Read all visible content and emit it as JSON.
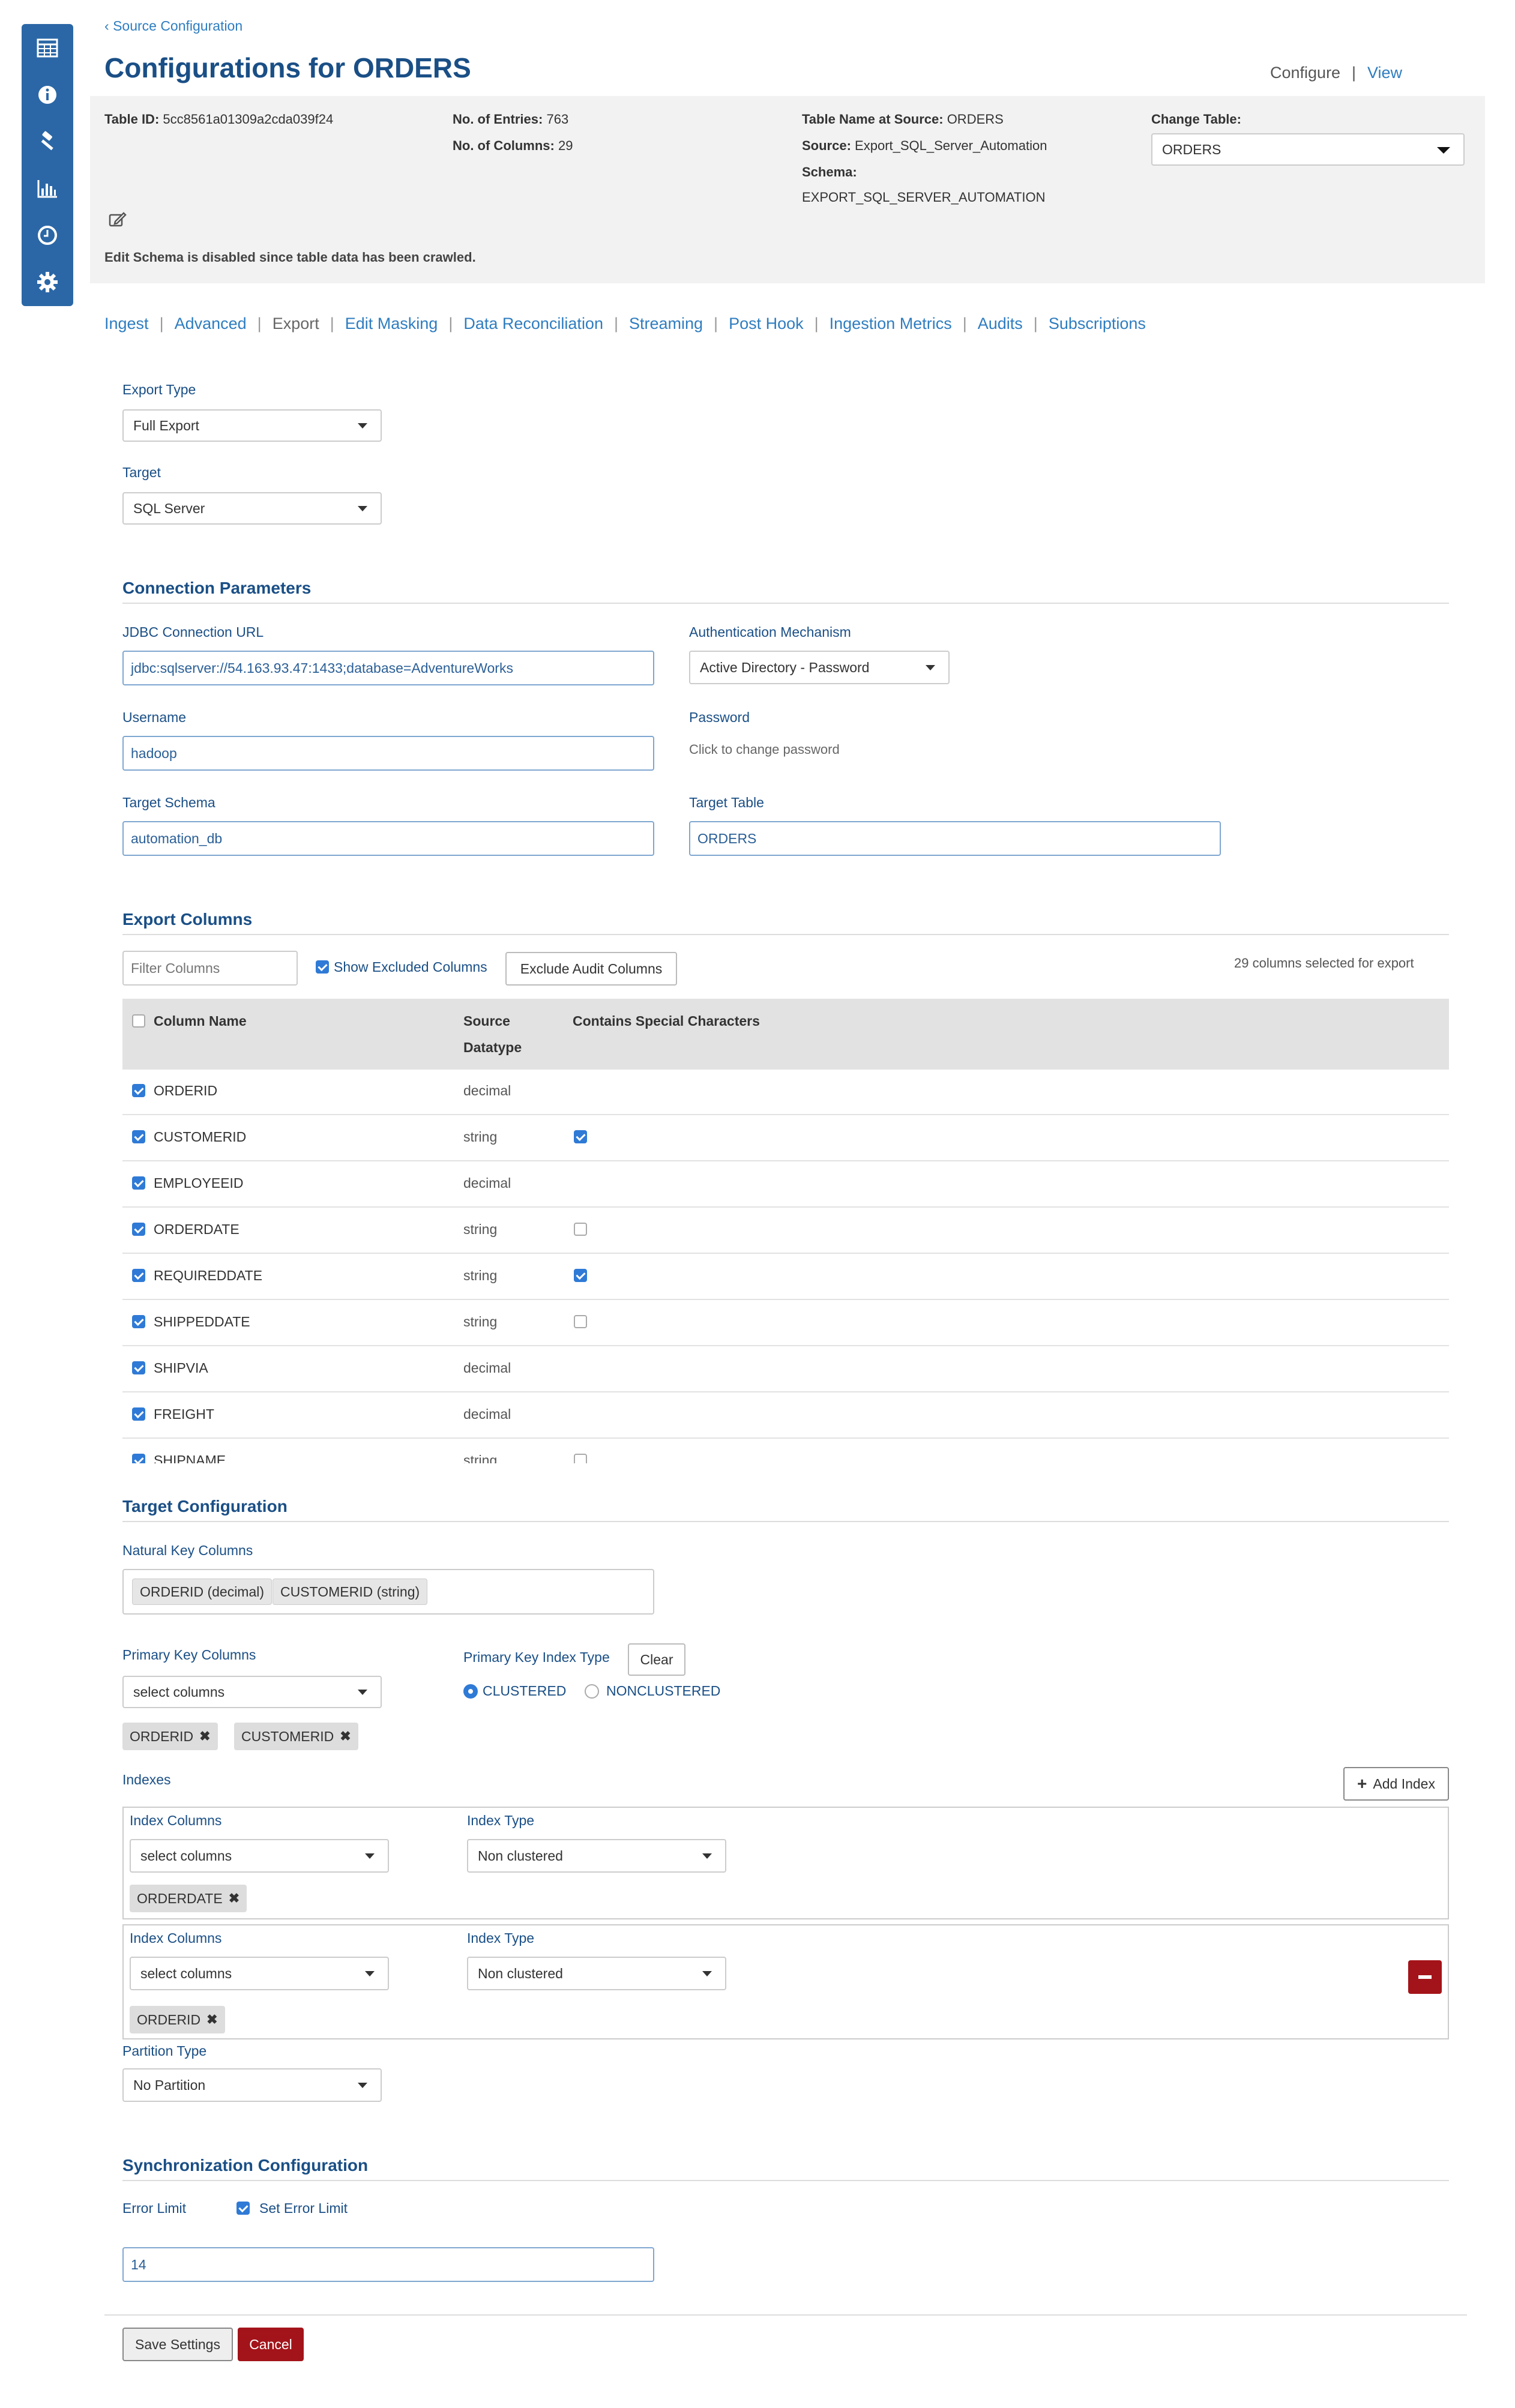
{
  "breadcrumb": "Source Configuration",
  "page_title": "Configurations for ORDERS",
  "header_links": {
    "configure": "Configure",
    "separator": "|",
    "view": "View"
  },
  "info": {
    "table_id_label": "Table ID:",
    "table_id": "5cc8561a01309a2cda039f24",
    "entries_label": "No. of Entries:",
    "entries": "763",
    "columns_label": "No. of Columns:",
    "columns": "29",
    "table_name_label": "Table Name at Source:",
    "table_name": "ORDERS",
    "source_label": "Source:",
    "source": "Export_SQL_Server_Automation",
    "schema_label": "Schema:",
    "schema": "EXPORT_SQL_SERVER_AUTOMATION",
    "change_table_label": "Change Table:",
    "change_table_value": "ORDERS",
    "schema_note": "Edit Schema is disabled since table data has been crawled."
  },
  "tabs": [
    "Ingest",
    "Advanced",
    "Export",
    "Edit Masking",
    "Data Reconciliation",
    "Streaming",
    "Post Hook",
    "Ingestion Metrics",
    "Audits",
    "Subscriptions"
  ],
  "tab_separator": "|",
  "active_tab": "Export",
  "export": {
    "export_type_label": "Export Type",
    "export_type_value": "Full Export",
    "target_label": "Target",
    "target_value": "SQL Server"
  },
  "connection": {
    "title": "Connection Parameters",
    "jdbc_label": "JDBC Connection URL",
    "jdbc_value": "jdbc:sqlserver://54.163.93.47:1433;database=AdventureWorks",
    "auth_label": "Authentication Mechanism",
    "auth_value": "Active Directory - Password",
    "username_label": "Username",
    "username_value": "hadoop",
    "password_label": "Password",
    "password_hint": "Click to change password",
    "target_schema_label": "Target Schema",
    "target_schema_value": "automation_db",
    "target_table_label": "Target Table",
    "target_table_value": "ORDERS"
  },
  "export_columns": {
    "title": "Export Columns",
    "filter_placeholder": "Filter Columns",
    "show_excluded_label": "Show Excluded Columns",
    "show_excluded_checked": true,
    "exclude_audit_label": "Exclude Audit Columns",
    "selected_count_text": "29 columns selected for export",
    "headers": {
      "column_name": "Column Name",
      "source": "Source",
      "datatype": "Datatype",
      "special": "Contains Special Characters"
    },
    "rows": [
      {
        "name": "ORDERID",
        "type": "decimal",
        "special": null
      },
      {
        "name": "CUSTOMERID",
        "type": "string",
        "special": true
      },
      {
        "name": "EMPLOYEEID",
        "type": "decimal",
        "special": null
      },
      {
        "name": "ORDERDATE",
        "type": "string",
        "special": false
      },
      {
        "name": "REQUIREDDATE",
        "type": "string",
        "special": true
      },
      {
        "name": "SHIPPEDDATE",
        "type": "string",
        "special": false
      },
      {
        "name": "SHIPVIA",
        "type": "decimal",
        "special": null
      },
      {
        "name": "FREIGHT",
        "type": "decimal",
        "special": null
      },
      {
        "name": "SHIPNAME",
        "type": "string",
        "special": false
      }
    ]
  },
  "target_config": {
    "title": "Target Configuration",
    "natural_key_label": "Natural Key Columns",
    "natural_keys": [
      "ORDERID (decimal)",
      "CUSTOMERID (string)"
    ],
    "pk_label": "Primary Key Columns",
    "pk_placeholder": "select columns",
    "pk_tags": [
      "ORDERID",
      "CUSTOMERID"
    ],
    "pk_index_type_label": "Primary Key Index Type",
    "clear_label": "Clear",
    "clustered_label": "CLUSTERED",
    "nonclustered_label": "NONCLUSTERED",
    "selected_index_type": "CLUSTERED",
    "indexes_label": "Indexes",
    "add_index_label": "Add Index",
    "indexes": [
      {
        "columns_label": "Index Columns",
        "columns_placeholder": "select columns",
        "type_label": "Index Type",
        "type_value": "Non clustered",
        "tags": [
          "ORDERDATE"
        ]
      },
      {
        "columns_label": "Index Columns",
        "columns_placeholder": "select columns",
        "type_label": "Index Type",
        "type_value": "Non clustered",
        "tags": [
          "ORDERID"
        ]
      }
    ],
    "partition_label": "Partition Type",
    "partition_value": "No Partition"
  },
  "sync": {
    "title": "Synchronization Configuration",
    "error_limit_label": "Error Limit",
    "set_error_limit_label": "Set Error Limit",
    "set_error_limit_checked": true,
    "error_limit_value": "14"
  },
  "footer": {
    "save_label": "Save Settings",
    "cancel_label": "Cancel"
  },
  "colors": {
    "sidebar": "#2b67a6",
    "link": "#2e7dc0",
    "heading": "#1a4f86",
    "cancel": "#a3141a",
    "info_bg": "#f2f2f2"
  },
  "sidebar_icons": [
    "table-icon",
    "info-icon",
    "hammer-icon",
    "bar-chart-icon",
    "clock-icon",
    "gear-icon"
  ]
}
